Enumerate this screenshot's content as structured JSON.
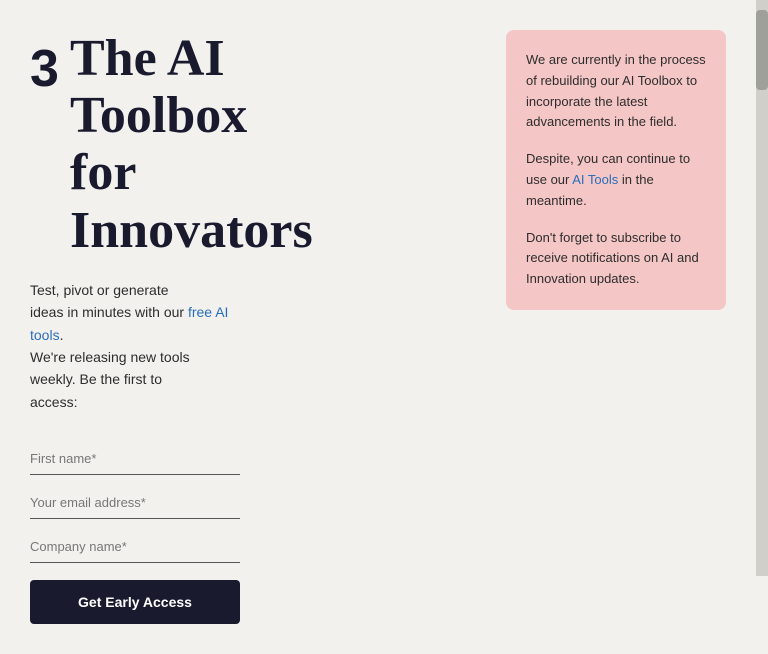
{
  "logo": {
    "alt": "3 Logo",
    "symbol": "3"
  },
  "hero": {
    "title_line1": "The AI",
    "title_line2": "Toolbox",
    "title_line3": "for",
    "title_line4": "Innovators"
  },
  "subtitle": {
    "line1": "Test, pivot or generate",
    "line2": "ideas in minutes with our",
    "link_text": "free AI tools",
    "line3": ".",
    "line4": "We're releasing new tools",
    "line5": "weekly. Be the first to",
    "line6": "access:"
  },
  "form": {
    "first_name_placeholder": "First name*",
    "email_placeholder": "Your email address*",
    "company_placeholder": "Company name*",
    "submit_label": "Get Early Access"
  },
  "notice": {
    "paragraph1": "We are currently in the process of rebuilding our AI Toolbox to incorporate the latest advancements in the field.",
    "paragraph2": "Despite, you can continue to use our AI Tools in the meantime.",
    "paragraph3": "Don't forget to subscribe to receive notifications on AI and Innovation updates."
  }
}
